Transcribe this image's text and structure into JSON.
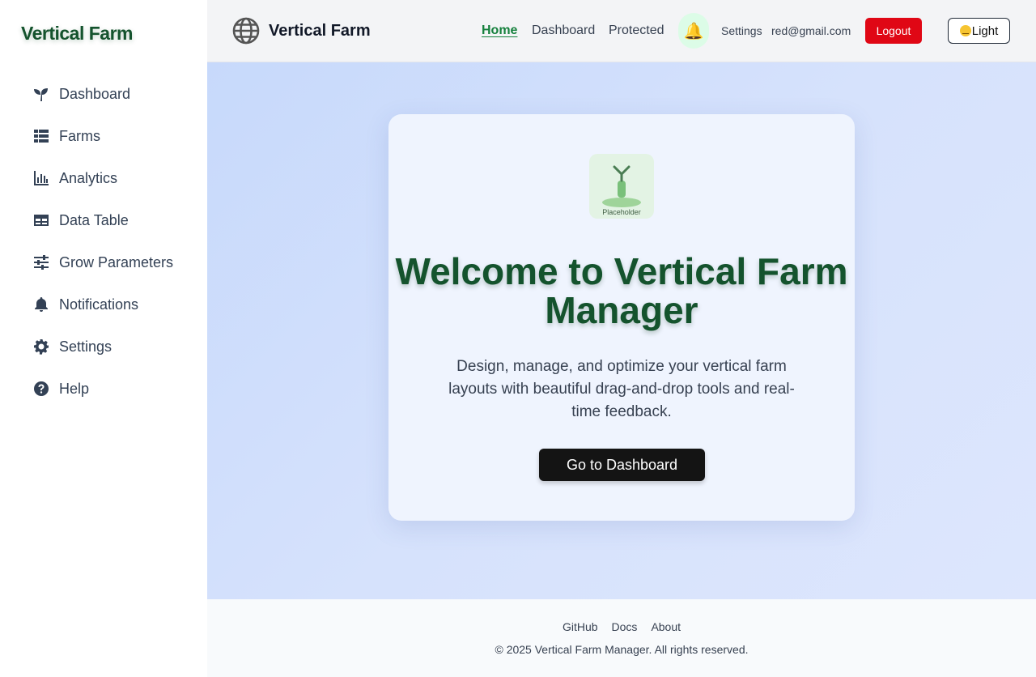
{
  "sidebar": {
    "brand": "Vertical Farm",
    "items": [
      {
        "label": "Dashboard",
        "icon": "seedling-icon"
      },
      {
        "label": "Farms",
        "icon": "list-icon"
      },
      {
        "label": "Analytics",
        "icon": "bar-chart-icon"
      },
      {
        "label": "Data Table",
        "icon": "table-icon"
      },
      {
        "label": "Grow Parameters",
        "icon": "sliders-icon"
      },
      {
        "label": "Notifications",
        "icon": "bell-icon"
      },
      {
        "label": "Settings",
        "icon": "gear-icon"
      },
      {
        "label": "Help",
        "icon": "question-circle-icon"
      }
    ]
  },
  "header": {
    "logo_icon": "globe-icon",
    "title": "Vertical Farm",
    "nav": {
      "home": "Home",
      "dashboard": "Dashboard",
      "protected": "Protected"
    },
    "bell_icon": "bell-emoji-icon",
    "settings": "Settings",
    "email": "red@gmail.com",
    "logout": "Logout",
    "theme_label": "Light",
    "theme_icon": "smiley-icon"
  },
  "main": {
    "image_placeholder": "Placeholder",
    "title": "Welcome to Vertical Farm Manager",
    "subtitle": "Design, manage, and optimize your vertical farm layouts with beautiful drag-and-drop tools and real-time feedback.",
    "cta": "Go to Dashboard"
  },
  "footer": {
    "links": [
      "GitHub",
      "Docs",
      "About"
    ],
    "copyright": "© 2025 Vertical Farm Manager. All rights reserved."
  },
  "colors": {
    "brand_green": "#14532d",
    "active_link": "#15803d",
    "logout_red": "#e00715",
    "cta_black": "#141414"
  }
}
